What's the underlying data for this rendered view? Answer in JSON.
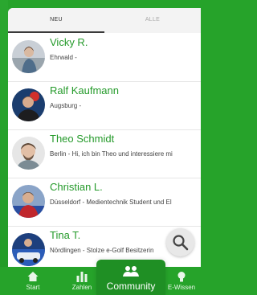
{
  "tabs": {
    "neu": "NEU",
    "alle": "ALLE"
  },
  "users": [
    {
      "name": "Vicky R.",
      "subtitle": "Ehrwald -"
    },
    {
      "name": "Ralf Kaufmann",
      "subtitle": "Augsburg -"
    },
    {
      "name": "Theo Schmidt",
      "subtitle": "Berlin - Hi, ich bin Theo und interessiere mi"
    },
    {
      "name": "Christian L.",
      "subtitle": "Düsseldorf - Medientechnik Student und El"
    },
    {
      "name": "Tina T.",
      "subtitle": "Nördlingen - Stolze e-Golf Besitzerin"
    }
  ],
  "nav": {
    "start": "Start",
    "zahlen": "Zahlen",
    "community": "Community",
    "ewissen": "E-Wissen"
  },
  "colors": {
    "accent": "#26a32a",
    "name_green": "#249a2a"
  }
}
